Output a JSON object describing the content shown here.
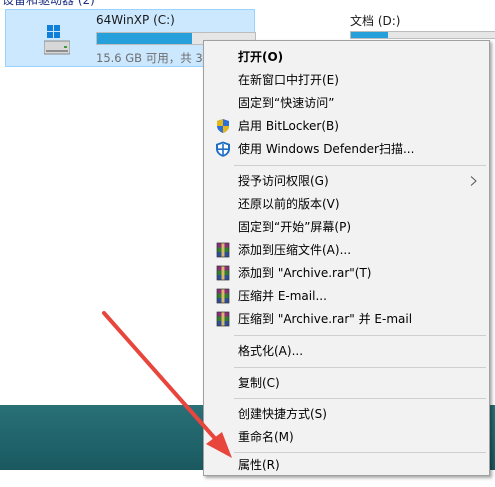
{
  "explorer": {
    "group_header": "设备和驱动器 (2)",
    "drive_c": {
      "name": "64WinXP   (C:)",
      "info": "15.6 GB 可用，共 3",
      "used_fraction": 0.6
    },
    "drive_d": {
      "name": "文档 (D:)",
      "used_fraction": 0.25
    }
  },
  "context_menu": {
    "items": [
      {
        "label": "打开(O)",
        "icon": ""
      },
      {
        "label": "在新窗口中打开(E)",
        "icon": ""
      },
      {
        "label": "固定到“快速访问”",
        "icon": ""
      },
      {
        "label": "启用 BitLocker(B)",
        "icon": "uac-shield-icon"
      },
      {
        "label": "使用 Windows Defender扫描...",
        "icon": "windows-defender-icon"
      },
      {
        "label": "授予访问权限(G)",
        "icon": ""
      },
      {
        "label": "还原以前的版本(V)",
        "icon": ""
      },
      {
        "label": "固定到“开始”屏幕(P)",
        "icon": ""
      },
      {
        "label": "添加到压缩文件(A)...",
        "icon": "winrar-icon"
      },
      {
        "label": "添加到 \"Archive.rar\"(T)",
        "icon": "winrar-icon"
      },
      {
        "label": "压缩并 E-mail...",
        "icon": "winrar-icon"
      },
      {
        "label": "压缩到 \"Archive.rar\" 并 E-mail",
        "icon": "winrar-icon"
      },
      {
        "label": "格式化(A)...",
        "icon": ""
      },
      {
        "label": "复制(C)",
        "icon": ""
      },
      {
        "label": "创建快捷方式(S)",
        "icon": ""
      },
      {
        "label": "重命名(M)",
        "icon": ""
      },
      {
        "label": "属性(R)",
        "icon": ""
      }
    ]
  },
  "annotation": {
    "arrow_color": "#e8453c"
  },
  "colors": {
    "selection_bg": "#cce8ff",
    "bar_fill": "#26a0da",
    "desktop": "#1d5f66"
  }
}
